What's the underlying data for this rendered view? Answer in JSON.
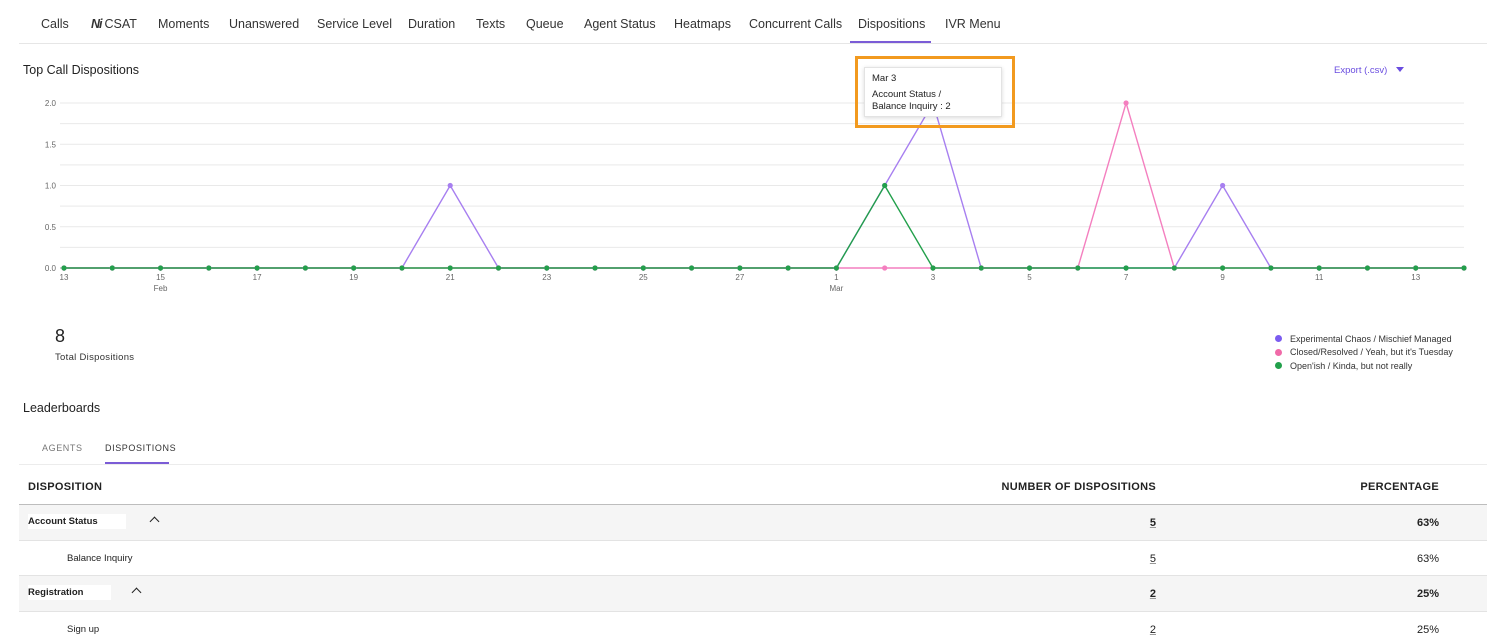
{
  "nav_tabs": [
    {
      "label": "Calls"
    },
    {
      "label": "CSAT",
      "icon": "ni-logo-icon"
    },
    {
      "label": "Moments"
    },
    {
      "label": "Unanswered"
    },
    {
      "label": "Service Level"
    },
    {
      "label": "Duration"
    },
    {
      "label": "Texts"
    },
    {
      "label": "Queue"
    },
    {
      "label": "Agent Status"
    },
    {
      "label": "Heatmaps"
    },
    {
      "label": "Concurrent Calls"
    },
    {
      "label": "Dispositions",
      "active": true
    },
    {
      "label": "IVR Menu"
    }
  ],
  "csat_mark": "Ni",
  "chart": {
    "title": "Top Call Dispositions",
    "export_label": "Export (.csv)"
  },
  "tooltip": {
    "date": "Mar 3",
    "line1": "Account Status /",
    "line2": "Balance Inquiry : 2"
  },
  "chart_data": {
    "type": "line",
    "ylim": [
      0,
      2
    ],
    "yticks": [
      "0.0",
      "0.5",
      "1.0",
      "1.5",
      "2.0"
    ],
    "x_tick_labels": [
      "13",
      "15",
      "17",
      "19",
      "21",
      "23",
      "25",
      "27",
      "1",
      "3",
      "5",
      "7",
      "9",
      "11",
      "13"
    ],
    "x_month_labels": [
      {
        "at": "15",
        "label": "Feb"
      },
      {
        "at": "1",
        "label": "Mar"
      }
    ],
    "x": [
      "Feb 13",
      "Feb 14",
      "Feb 15",
      "Feb 16",
      "Feb 17",
      "Feb 18",
      "Feb 19",
      "Feb 20",
      "Feb 21",
      "Feb 22",
      "Feb 23",
      "Feb 24",
      "Feb 25",
      "Feb 26",
      "Feb 27",
      "Feb 28",
      "Mar 1",
      "Mar 2",
      "Mar 3",
      "Mar 4",
      "Mar 5",
      "Mar 6",
      "Mar 7",
      "Mar 8",
      "Mar 9",
      "Mar 10",
      "Mar 11",
      "Mar 12",
      "Mar 13",
      "Mar 14"
    ],
    "series": [
      {
        "name": "Experimental Chaos / Mischief Managed",
        "color": "#a77ff0",
        "values": [
          0,
          0,
          0,
          0,
          0,
          0,
          0,
          0,
          1,
          0,
          0,
          0,
          0,
          0,
          0,
          0,
          0,
          1,
          2,
          0,
          0,
          0,
          0,
          0,
          1,
          0,
          0,
          0,
          0,
          0
        ]
      },
      {
        "name": "Closed/Resolved / Yeah, but it's Tuesday",
        "color": "#f47fbf",
        "values": [
          0,
          0,
          0,
          0,
          0,
          0,
          0,
          0,
          0,
          0,
          0,
          0,
          0,
          0,
          0,
          0,
          0,
          0,
          0,
          0,
          0,
          0,
          2,
          0,
          0,
          0,
          0,
          0,
          0,
          0
        ]
      },
      {
        "name": "Open'ish / Kinda, but not really",
        "color": "#22a04b",
        "values": [
          0,
          0,
          0,
          0,
          0,
          0,
          0,
          0,
          0,
          0,
          0,
          0,
          0,
          0,
          0,
          0,
          0,
          1,
          0,
          0,
          0,
          0,
          0,
          0,
          0,
          0,
          0,
          0,
          0,
          0
        ]
      }
    ]
  },
  "legend": [
    {
      "label": "Experimental Chaos / Mischief Managed",
      "color": "#7b5cf0"
    },
    {
      "label": "Closed/Resolved / Yeah, but it's Tuesday",
      "color": "#f06aa8"
    },
    {
      "label": "Open'ish / Kinda, but not really",
      "color": "#22a04b"
    }
  ],
  "totals": {
    "value": "8",
    "label": "Total Dispositions"
  },
  "leaderboards": {
    "title": "Leaderboards",
    "tabs": [
      {
        "label": "AGENTS"
      },
      {
        "label": "DISPOSITIONS",
        "active": true
      }
    ],
    "columns": [
      "DISPOSITION",
      "NUMBER OF DISPOSITIONS",
      "PERCENTAGE"
    ],
    "rows": [
      {
        "type": "group",
        "name": "Account Status",
        "count": "5",
        "pct": "63%"
      },
      {
        "type": "child",
        "name": "Balance Inquiry",
        "count": "5",
        "pct": "63%"
      },
      {
        "type": "group",
        "name": "Registration",
        "count": "2",
        "pct": "25%"
      },
      {
        "type": "child",
        "name": "Sign up",
        "count": "2",
        "pct": "25%"
      }
    ]
  }
}
